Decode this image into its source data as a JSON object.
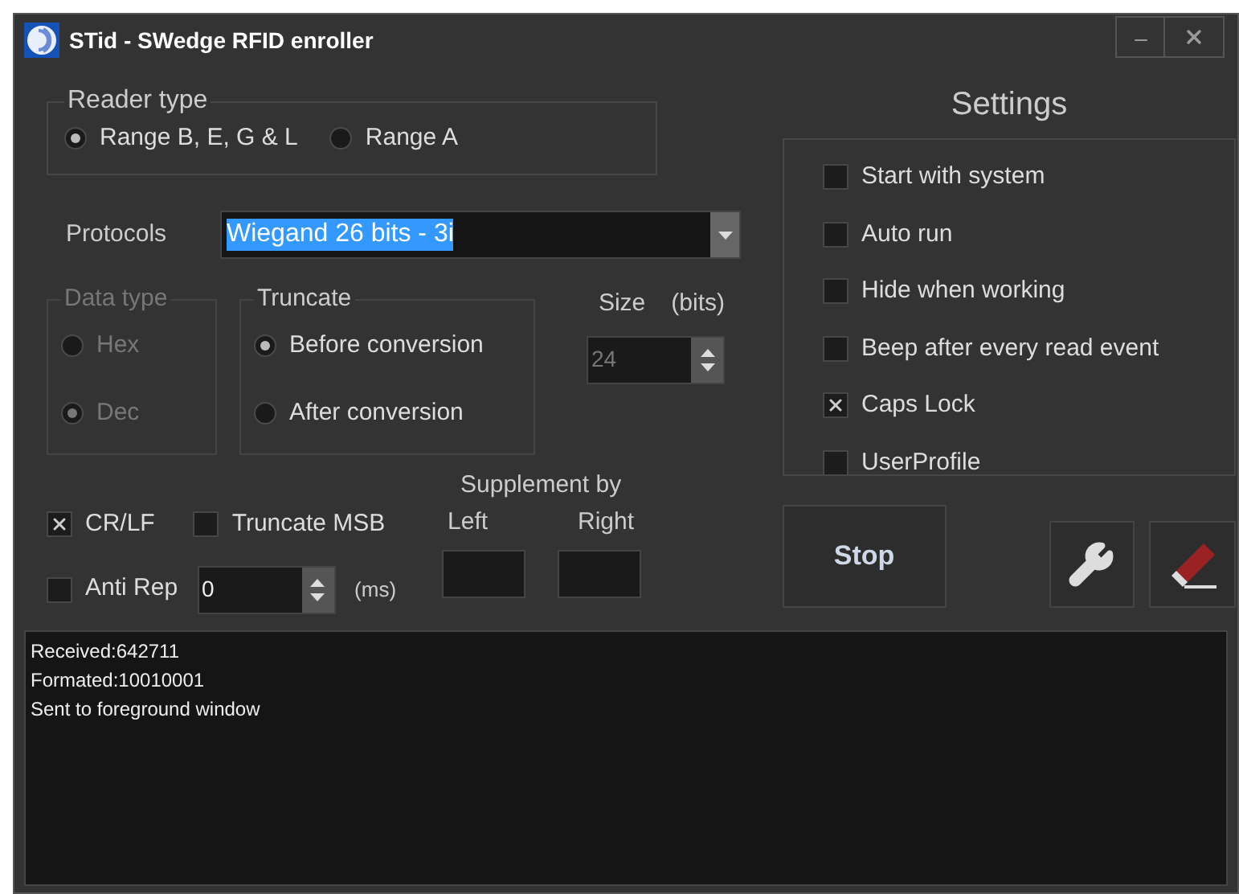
{
  "window": {
    "title": "STid - SWedge RFID enroller"
  },
  "reader_type": {
    "label": "Reader type",
    "options": [
      {
        "label": "Range B, E, G & L",
        "selected": true
      },
      {
        "label": "Range A",
        "selected": false
      }
    ]
  },
  "protocols": {
    "label": "Protocols",
    "value": "Wiegand 26 bits - 3i"
  },
  "data_type": {
    "label": "Data type",
    "disabled": true,
    "options": [
      {
        "label": "Hex",
        "selected": false
      },
      {
        "label": "Dec",
        "selected": true
      }
    ]
  },
  "truncate": {
    "label": "Truncate",
    "options": [
      {
        "label": "Before conversion",
        "selected": true
      },
      {
        "label": "After conversion",
        "selected": false
      }
    ]
  },
  "size": {
    "label": "Size",
    "unit": "(bits)",
    "value": "24",
    "disabled": true
  },
  "checks": [
    {
      "label": "CR/LF",
      "checked": true
    },
    {
      "label": "Truncate MSB",
      "checked": false
    }
  ],
  "anti_rep": {
    "label": "Anti Rep",
    "checked": false,
    "value": "0",
    "unit": "(ms)"
  },
  "supplement": {
    "label": "Supplement by",
    "left_label": "Left",
    "right_label": "Right"
  },
  "settings": {
    "title": "Settings",
    "items": [
      {
        "label": "Start with system",
        "checked": false
      },
      {
        "label": "Auto run",
        "checked": false
      },
      {
        "label": "Hide when working",
        "checked": false
      },
      {
        "label": "Beep after every read event",
        "checked": false
      },
      {
        "label": "Caps Lock",
        "checked": true
      },
      {
        "label": "UserProfile",
        "checked": false
      }
    ]
  },
  "stop_button": {
    "label": "Stop"
  },
  "log": {
    "lines": [
      "Received:642711",
      "Formated:10010001",
      "Sent to foreground window"
    ]
  }
}
